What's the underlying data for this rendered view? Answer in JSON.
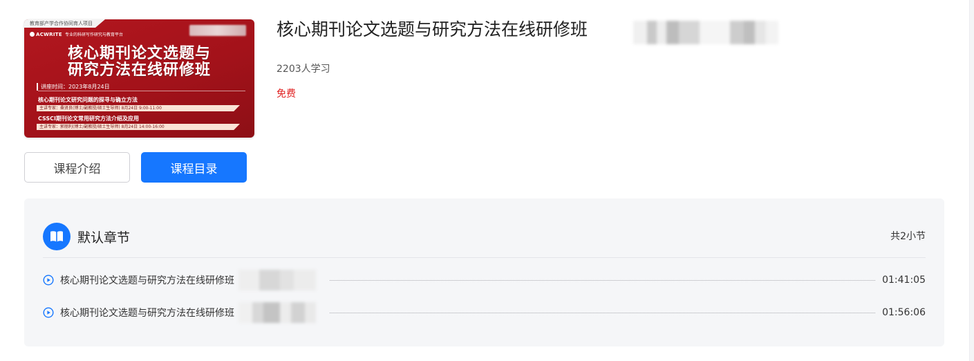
{
  "cover": {
    "project_tab": "教育部产学合作协同育人项目",
    "brand_logo": "ACWRITE",
    "brand_slogan": "专业的科研写作研究与教育平台",
    "title_line1": "核心期刊论文选题与",
    "title_line2": "研究方法在线研修班",
    "date_line": "讲座时间：2023年8月24日",
    "topic1": "核心期刊论文研究问题的探寻与确立方法",
    "speaker1": "主讲专家：桑贤良(博士/副教授/硕士生导师) 8月24日 9:00-11:00",
    "topic2": "CSSCI期刊论文常用研究方法介绍及应用",
    "speaker2": "主讲专家：郭丽利(博士/副教授/硕士生导师) 8月24日 14:00-16:00"
  },
  "course": {
    "title": "核心期刊论文选题与研究方法在线研修班",
    "learners": "2203人学习",
    "price": "免费"
  },
  "tabs": {
    "intro_label": "课程介绍",
    "catalog_label": "课程目录"
  },
  "chapter": {
    "name": "默认章节",
    "count": "共2小节",
    "lessons": [
      {
        "title": "核心期刊论文选题与研究方法在线研修班",
        "duration": "01:41:05"
      },
      {
        "title": "核心期刊论文选题与研究方法在线研修班",
        "duration": "01:56:06"
      }
    ]
  },
  "colors": {
    "accent": "#1677ff",
    "price": "#e02020",
    "cover_red": "#a3121a",
    "panel_bg": "#f5f6f8"
  }
}
